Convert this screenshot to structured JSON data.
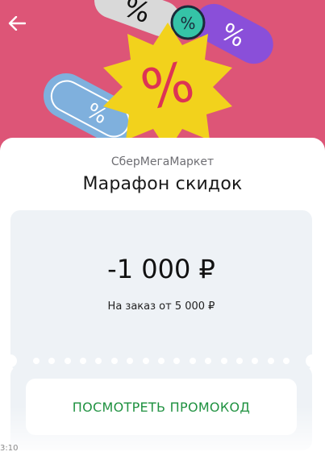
{
  "header": {
    "back_icon": "arrow-left-icon",
    "hero_colors": {
      "background": "#dd5577",
      "grey_tag": "#d9d9d9",
      "purple_tag": "#8a4fd9",
      "yellow_badge": "#f2d21c",
      "blue_tag": "#7fb0dd",
      "teal_badge": "#35c3a7"
    }
  },
  "sheet": {
    "brand": "СберМегаМаркет",
    "title": "Марафон скидок"
  },
  "coupon": {
    "amount": "-1 000 ₽",
    "condition": "На заказ от 5 000 ₽",
    "background_color": "#eef2f6"
  },
  "actions": {
    "show_promo_label": "ПОСМОТРЕТЬ ПРОМОКОД",
    "accent_color": "#1a8f3c"
  },
  "status": {
    "time": "3:10"
  }
}
